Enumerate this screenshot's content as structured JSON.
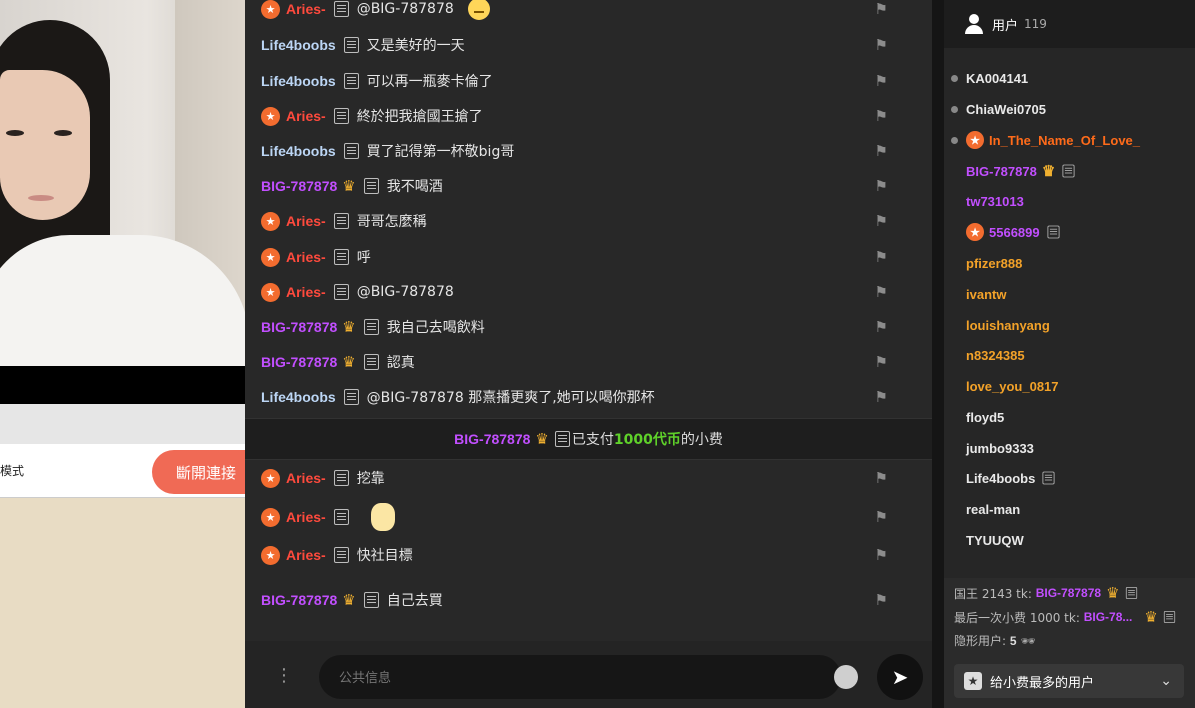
{
  "left": {
    "mode_label": "模式",
    "disconnect_label": "斷開連接"
  },
  "chat": {
    "messages": [
      {
        "user": "Aries-",
        "text": "@BIG-787878"
      },
      {
        "user": "Life4boobs",
        "text": "又是美好的一天"
      },
      {
        "user": "Life4boobs",
        "text": "可以再一瓶麥卡倫了"
      },
      {
        "user": "Aries-",
        "text": "終於把我搶國王搶了"
      },
      {
        "user": "Life4boobs",
        "text": "買了記得第一杯敬big哥"
      },
      {
        "user": "BIG-787878",
        "text": "我不喝酒"
      },
      {
        "user": "Aries-",
        "text": "哥哥怎麼稱"
      },
      {
        "user": "Aries-",
        "text": "呼"
      },
      {
        "user": "Aries-",
        "text": "@BIG-787878"
      },
      {
        "user": "BIG-787878",
        "text": "我自己去喝飲料"
      },
      {
        "user": "BIG-787878",
        "text": "認真"
      },
      {
        "user": "Life4boobs",
        "text": "@BIG-787878  那熹播更爽了,她可以喝你那杯"
      },
      {
        "user": "Aries-",
        "text": "挖靠"
      },
      {
        "user": "Aries-",
        "text": ""
      },
      {
        "user": "Aries-",
        "text": "快社目標"
      },
      {
        "user": "BIG-787878",
        "text": "自己去買"
      }
    ],
    "tip": {
      "user": "BIG-787878",
      "prefix": "已支付",
      "amount": "1000代币",
      "suffix": "的小费"
    },
    "input_placeholder": "公共信息"
  },
  "users": {
    "title": "用户",
    "count": "119",
    "list": [
      {
        "name": "KA004141"
      },
      {
        "name": "ChiaWei0705"
      },
      {
        "name": "In_The_Name_Of_Love_"
      },
      {
        "name": "BIG-787878"
      },
      {
        "name": "tw731013"
      },
      {
        "name": "5566899"
      },
      {
        "name": "pfizer888"
      },
      {
        "name": "ivantw"
      },
      {
        "name": "louishanyang"
      },
      {
        "name": "n8324385"
      },
      {
        "name": "love_you_0817"
      },
      {
        "name": "floyd5"
      },
      {
        "name": "jumbo9333"
      },
      {
        "name": "Life4boobs"
      },
      {
        "name": "real-man"
      },
      {
        "name": "TYUUQW"
      }
    ],
    "king_label": "国王 2143 tk:",
    "king_user": "BIG-787878",
    "last_tip_label": "最后一次小费 1000 tk:",
    "last_tip_user": "BIG-78...",
    "hidden_label": "隐形用户:",
    "hidden_count": "5",
    "sort_label": "给小费最多的用户"
  },
  "colors": {
    "aries": "#ff4a3d",
    "life": "#bcd6f5",
    "big": "#c24fff",
    "tip_green": "#5fd12a",
    "disconnect": "#f06a55"
  }
}
